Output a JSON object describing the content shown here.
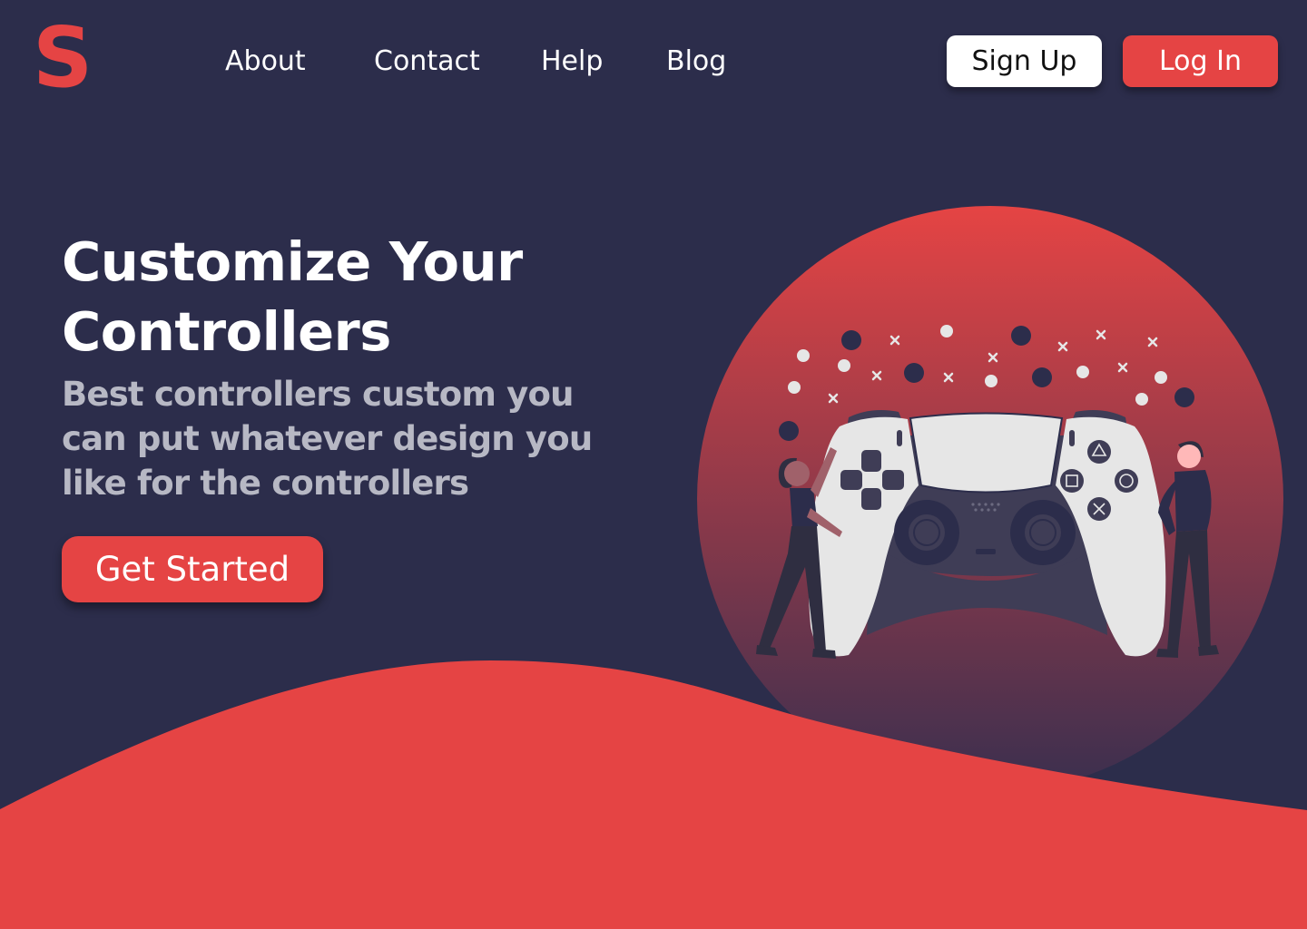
{
  "brand": {
    "logo_letter": "S",
    "accent_color": "#e54444",
    "background_color": "#2c2d4b"
  },
  "nav": {
    "items": [
      {
        "label": "About"
      },
      {
        "label": "Contact"
      },
      {
        "label": "Help"
      },
      {
        "label": "Blog"
      }
    ]
  },
  "auth": {
    "signup_label": "Sign Up",
    "login_label": "Log In"
  },
  "hero": {
    "title_line1": "Customize Your",
    "title_line2": "Controllers",
    "subtitle": "Best controllers custom you can put whatever design you like for the controllers",
    "cta_label": "Get Started"
  },
  "illustration": {
    "icon": "game-controller-illustration",
    "controller_buttons": [
      "triangle-icon",
      "square-icon",
      "circle-icon",
      "cross-icon"
    ]
  }
}
